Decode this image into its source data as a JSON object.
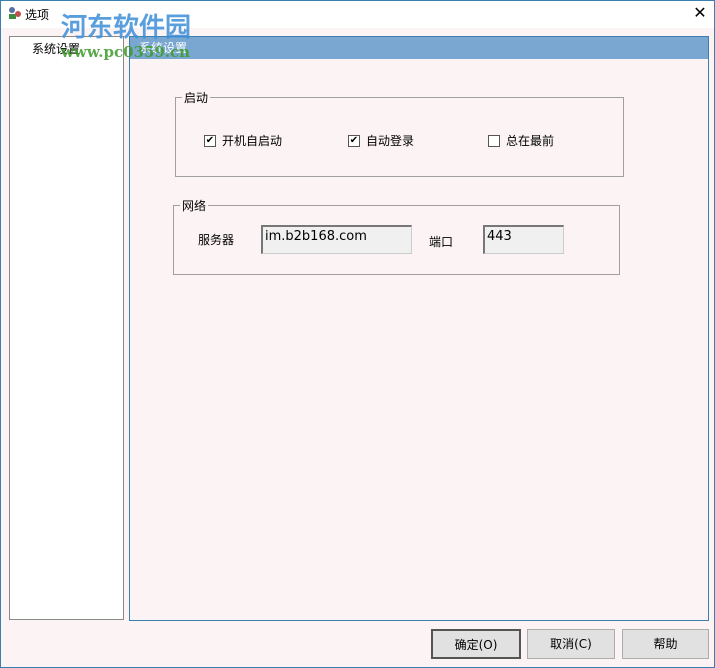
{
  "window": {
    "title": "选项",
    "close": "✕"
  },
  "sidebar": {
    "items": [
      {
        "label": "系统设置"
      }
    ]
  },
  "panel": {
    "header": "系统设置",
    "startup": {
      "legend": "启动",
      "options": [
        {
          "label": "开机自启动",
          "checked": true
        },
        {
          "label": "自动登录",
          "checked": true
        },
        {
          "label": "总在最前",
          "checked": false
        }
      ]
    },
    "network": {
      "legend": "网络",
      "server_label": "服务器",
      "server_value": "im.b2b168.com",
      "port_label": "端口",
      "port_value": "443"
    }
  },
  "buttons": {
    "ok": "确定(O)",
    "cancel": "取消(C)",
    "help": "帮助"
  },
  "watermark": {
    "name": "河东软件园",
    "url": "www.pc0359.cn"
  }
}
